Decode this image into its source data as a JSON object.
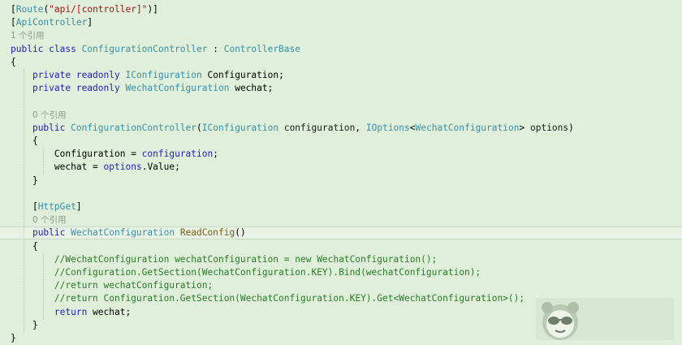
{
  "editor": {
    "background": "#dfefd9",
    "colors": {
      "keyword": "#1f1fb8",
      "type": "#3a8fa8",
      "string": "#a31515",
      "comment": "#2b7a2b",
      "codelens": "#8c9a8a"
    },
    "lines": [
      [
        [
          "pn",
          "["
        ],
        [
          "ty",
          "Route"
        ],
        [
          "pn",
          "("
        ],
        [
          "str",
          "\"api/[controller]\""
        ],
        [
          "pn",
          ")]"
        ]
      ],
      [
        [
          "pn",
          "["
        ],
        [
          "ty",
          "ApiController"
        ],
        [
          "pn",
          "]"
        ]
      ],
      [
        [
          "ref",
          "1 个引用"
        ]
      ],
      [
        [
          "kw",
          "public class "
        ],
        [
          "ty",
          "ConfigurationController"
        ],
        [
          "pn",
          " : "
        ],
        [
          "ty",
          "ControllerBase"
        ]
      ],
      [
        [
          "pn",
          "{"
        ]
      ],
      [
        [
          "pn",
          "    "
        ],
        [
          "kw",
          "private readonly "
        ],
        [
          "ty",
          "IConfiguration"
        ],
        [
          "pn",
          " "
        ],
        [
          "id",
          "Configuration"
        ],
        [
          "pn",
          ";"
        ]
      ],
      [
        [
          "pn",
          "    "
        ],
        [
          "kw",
          "private readonly "
        ],
        [
          "ty",
          "WechatConfiguration"
        ],
        [
          "pn",
          " "
        ],
        [
          "id",
          "wechat"
        ],
        [
          "pn",
          ";"
        ]
      ],
      [],
      [
        [
          "pn",
          "    "
        ],
        [
          "ref",
          "0 个引用"
        ]
      ],
      [
        [
          "pn",
          "    "
        ],
        [
          "kw",
          "public "
        ],
        [
          "ty",
          "ConfigurationController"
        ],
        [
          "pn",
          "("
        ],
        [
          "ty",
          "IConfiguration"
        ],
        [
          "pn",
          " "
        ],
        [
          "prm",
          "configuration"
        ],
        [
          "pn",
          ", "
        ],
        [
          "ty",
          "IOptions"
        ],
        [
          "pn",
          "<"
        ],
        [
          "ty",
          "WechatConfiguration"
        ],
        [
          "pn",
          "> "
        ],
        [
          "prm",
          "options"
        ],
        [
          "pn",
          ")"
        ]
      ],
      [
        [
          "pn",
          "    {"
        ]
      ],
      [
        [
          "pn",
          "        "
        ],
        [
          "id",
          "Configuration"
        ],
        [
          "pn",
          " = "
        ],
        [
          "kw",
          "configuration"
        ],
        [
          "pn",
          ";"
        ]
      ],
      [
        [
          "pn",
          "        "
        ],
        [
          "id",
          "wechat"
        ],
        [
          "pn",
          " = "
        ],
        [
          "kw",
          "options"
        ],
        [
          "pn",
          "."
        ],
        [
          "id",
          "Value"
        ],
        [
          "pn",
          ";"
        ]
      ],
      [
        [
          "pn",
          "    }"
        ]
      ],
      [],
      [
        [
          "pn",
          "    ["
        ],
        [
          "ty",
          "HttpGet"
        ],
        [
          "pn",
          "]"
        ]
      ],
      [
        [
          "pn",
          "    "
        ],
        [
          "ref",
          "0 个引用"
        ]
      ],
      [
        [
          "pn",
          "    "
        ],
        [
          "kw",
          "public "
        ],
        [
          "ty",
          "WechatConfiguration"
        ],
        [
          "pn",
          " "
        ],
        [
          "mth",
          "ReadConfig"
        ],
        [
          "pn",
          "()"
        ]
      ],
      [
        [
          "pn",
          "    {"
        ]
      ],
      [
        [
          "pn",
          "        "
        ],
        [
          "cm",
          "//WechatConfiguration wechatConfiguration = new WechatConfiguration();"
        ]
      ],
      [
        [
          "pn",
          "        "
        ],
        [
          "cm",
          "//Configuration.GetSection(WechatConfiguration.KEY).Bind(wechatConfiguration);"
        ]
      ],
      [
        [
          "pn",
          "        "
        ],
        [
          "cm",
          "//return wechatConfiguration;"
        ]
      ],
      [
        [
          "pn",
          "        "
        ],
        [
          "cm",
          "//return Configuration.GetSection(WechatConfiguration.KEY).Get<WechatConfiguration>();"
        ]
      ],
      [
        [
          "pn",
          "        "
        ],
        [
          "kw",
          "return "
        ],
        [
          "id",
          "wechat"
        ],
        [
          "pn",
          ";"
        ]
      ],
      [
        [
          "pn",
          "    }"
        ]
      ],
      [
        [
          "pn",
          "}"
        ]
      ]
    ]
  },
  "overlay": {
    "logo_icon": "panda-sunglasses-icon"
  }
}
